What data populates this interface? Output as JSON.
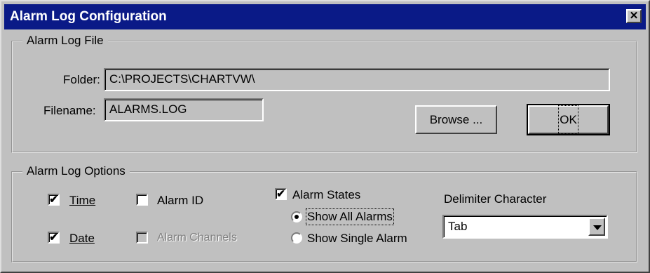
{
  "window": {
    "title": "Alarm Log Configuration",
    "close_glyph": "✕"
  },
  "file_group": {
    "title": "Alarm Log File",
    "folder_label": "Folder:",
    "folder_value": "C:\\PROJECTS\\CHARTVW\\",
    "filename_label": "Filename:",
    "filename_value": "ALARMS.LOG",
    "browse_label": "Browse ...",
    "ok_label": "OK"
  },
  "options_group": {
    "title": "Alarm Log Options",
    "time": {
      "label": "Time",
      "checked": true
    },
    "date": {
      "label": "Date",
      "checked": true
    },
    "alarm_id": {
      "label": "Alarm ID",
      "checked": false
    },
    "alarm_channels": {
      "label": "Alarm Channels",
      "checked": false,
      "enabled": false
    },
    "alarm_states": {
      "label": "Alarm States",
      "checked": true
    },
    "radio_show_all": {
      "label": "Show All Alarms",
      "selected": true
    },
    "radio_show_single": {
      "label": "Show Single Alarm",
      "selected": false
    },
    "delimiter_label": "Delimiter Character",
    "delimiter_value": "Tab"
  },
  "check_glyph": "✔"
}
